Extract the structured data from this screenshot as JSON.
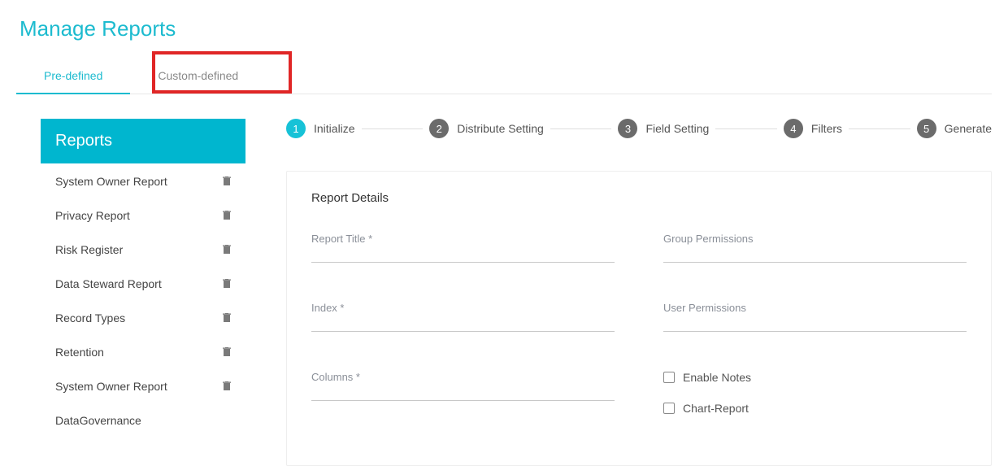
{
  "pageTitle": "Manage Reports",
  "tabs": {
    "predefined": "Pre-defined",
    "custom": "Custom-defined"
  },
  "sidebar": {
    "header": "Reports",
    "items": [
      {
        "label": "System Owner Report"
      },
      {
        "label": "Privacy Report"
      },
      {
        "label": "Risk Register"
      },
      {
        "label": "Data Steward Report"
      },
      {
        "label": "Record Types"
      },
      {
        "label": "Retention"
      },
      {
        "label": "System Owner Report"
      },
      {
        "label": "DataGovernance"
      }
    ]
  },
  "stepper": [
    {
      "num": "1",
      "label": "Initialize"
    },
    {
      "num": "2",
      "label": "Distribute Setting"
    },
    {
      "num": "3",
      "label": "Field Setting"
    },
    {
      "num": "4",
      "label": "Filters"
    },
    {
      "num": "5",
      "label": "Generate"
    }
  ],
  "card": {
    "title": "Report Details",
    "fields": {
      "reportTitle": "Report Title *",
      "groupPermissions": "Group Permissions",
      "index": "Index *",
      "userPermissions": "User Permissions",
      "columns": "Columns *"
    },
    "checks": {
      "enableNotes": "Enable Notes",
      "chartReport": "Chart-Report"
    }
  }
}
